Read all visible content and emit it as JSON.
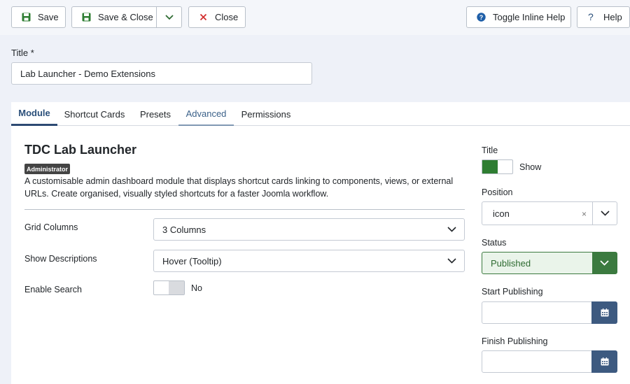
{
  "toolbar": {
    "save_label": "Save",
    "save_close_label": "Save & Close",
    "close_label": "Close",
    "inline_help_label": "Toggle Inline Help",
    "help_label": "Help"
  },
  "title_field": {
    "label": "Title *",
    "value": "Lab Launcher - Demo Extensions"
  },
  "tabs": [
    {
      "label": "Module"
    },
    {
      "label": "Shortcut Cards"
    },
    {
      "label": "Presets"
    },
    {
      "label": "Advanced"
    },
    {
      "label": "Permissions"
    }
  ],
  "module": {
    "heading": "TDC Lab Launcher",
    "badge": "Administrator",
    "description": "A customisable admin dashboard module that displays shortcut cards linking to components, views, or external URLs. Create organised, visually styled shortcuts for a faster Joomla workflow."
  },
  "options": {
    "grid_columns": {
      "label": "Grid Columns",
      "value": "3 Columns"
    },
    "show_descriptions": {
      "label": "Show Descriptions",
      "value": "Hover (Tooltip)"
    },
    "enable_search": {
      "label": "Enable Search",
      "value": "No"
    }
  },
  "sidebar": {
    "title": {
      "label": "Title",
      "value": "Show"
    },
    "position": {
      "label": "Position",
      "value": "icon"
    },
    "status": {
      "label": "Status",
      "value": "Published"
    },
    "start_publishing": {
      "label": "Start Publishing",
      "value": ""
    },
    "finish_publishing": {
      "label": "Finish Publishing",
      "value": ""
    }
  },
  "colors": {
    "accent": "#2d4a73",
    "success": "#2e7d32",
    "danger": "#d32f2f",
    "info": "#1f5fa8"
  },
  "icons": [
    "save-icon",
    "chevron-down-icon",
    "close-icon",
    "question-circle-icon",
    "question-icon",
    "clear-icon",
    "calendar-icon"
  ]
}
